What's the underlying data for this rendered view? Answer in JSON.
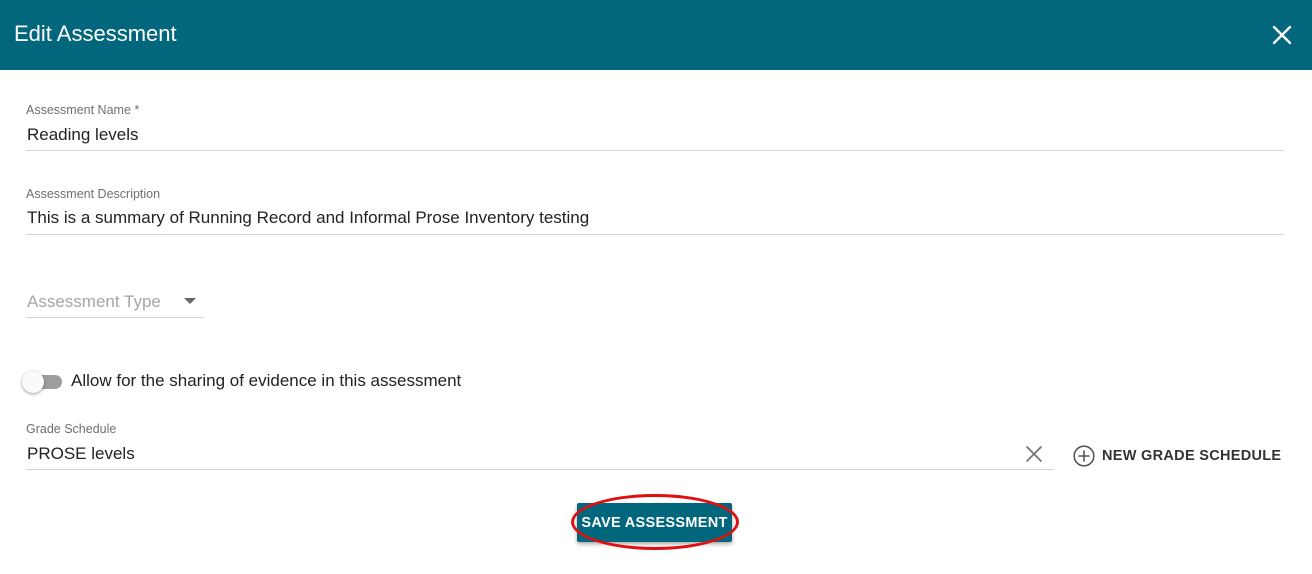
{
  "dialog": {
    "title": "Edit Assessment",
    "close_icon": "close-icon"
  },
  "assessment_name": {
    "label": "Assessment Name *",
    "value": "Reading levels"
  },
  "assessment_description": {
    "label": "Assessment Description",
    "value": "This is a summary of Running Record and Informal Prose Inventory testing"
  },
  "assessment_type": {
    "placeholder": "Assessment Type"
  },
  "sharing_toggle": {
    "label": "Allow for the sharing of evidence in this assessment",
    "state": "off"
  },
  "grade_schedule": {
    "label": "Grade Schedule",
    "value": "PROSE levels"
  },
  "new_grade_schedule": {
    "label": "NEW GRADE SCHEDULE"
  },
  "save": {
    "label": "SAVE ASSESSMENT"
  },
  "colors": {
    "primary": "#02677c",
    "annotation": "#e01010"
  }
}
